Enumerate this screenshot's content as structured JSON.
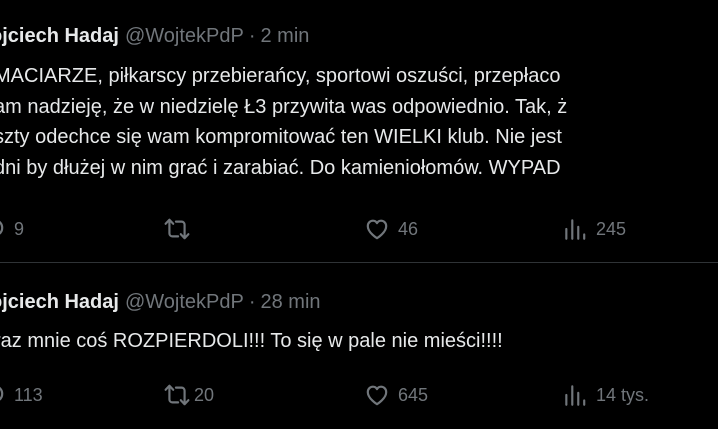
{
  "tweets": [
    {
      "author_name": "ojciech Hadaj",
      "handle": "@WojtekPdP",
      "separator": "·",
      "time": "2 min",
      "lines": [
        "MACIARZE, piłkarscy przebierańcy, sportowi oszuści, przepłaco",
        "am nadzieję, że w niedzielę Ł3 przywita was odpowiednio. Tak, ż",
        "szty odechce się wam kompromitować ten WIELKI klub. Nie jest",
        "dni by dłużej w nim grać i zarabiać. Do kamieniołomów. WYPAD"
      ],
      "reply_count": "9",
      "retweet_count": "",
      "like_count": "46",
      "view_count": "245"
    },
    {
      "author_name": "ojciech Hadaj",
      "handle": "@WojtekPdP",
      "separator": "·",
      "time": "28 min",
      "lines": [
        "raz mnie coś ROZPIERDOLI!!! To się w pale nie mieści!!!!"
      ],
      "reply_count": "113",
      "retweet_count": "20",
      "like_count": "645",
      "view_count": "14 tys."
    }
  ],
  "icons": {
    "reply": "reply-icon",
    "retweet": "retweet-icon",
    "like": "heart-icon",
    "views": "views-icon"
  },
  "colors": {
    "background": "#000000",
    "text": "#e7e9ea",
    "secondary": "#71767b",
    "divider": "#2f3336"
  }
}
